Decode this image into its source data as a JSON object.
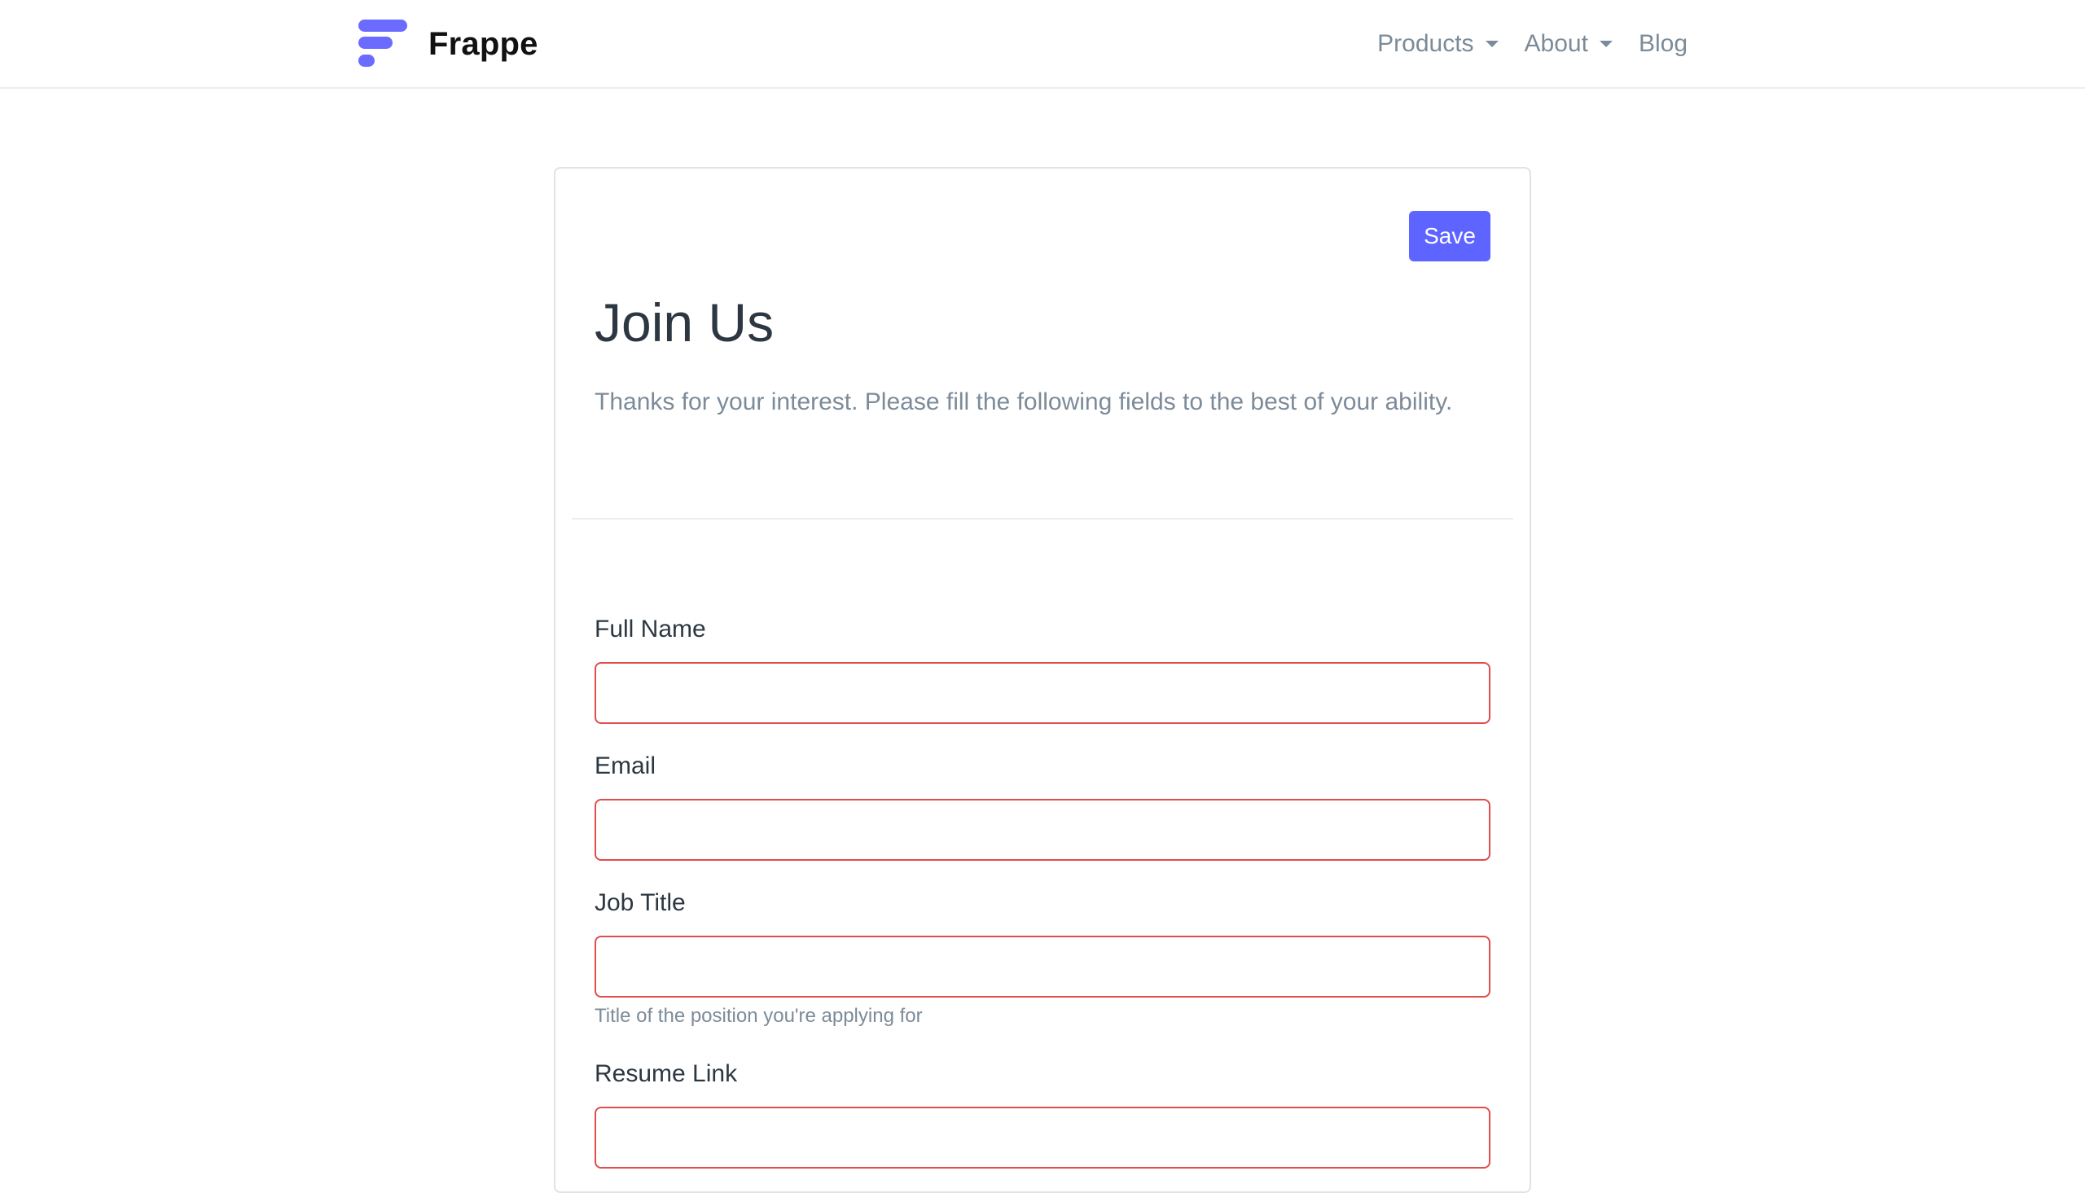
{
  "navbar": {
    "brand": "Frappe",
    "links": [
      {
        "label": "Products",
        "dropdown": true
      },
      {
        "label": "About",
        "dropdown": true
      },
      {
        "label": "Blog",
        "dropdown": false
      }
    ]
  },
  "form": {
    "save_label": "Save",
    "title": "Join Us",
    "intro": "Thanks for your interest. Please fill the following fields to the best of your ability.",
    "fields": [
      {
        "label": "Full Name",
        "value": ""
      },
      {
        "label": "Email",
        "value": ""
      },
      {
        "label": "Job Title",
        "value": "",
        "help": "Title of the position you're applying for"
      },
      {
        "label": "Resume Link",
        "value": ""
      }
    ]
  },
  "colors": {
    "accent": "#5e64ff",
    "logo": "#6b6bff",
    "invalid_border": "#e24c4c",
    "muted_text": "#7c8b99"
  }
}
